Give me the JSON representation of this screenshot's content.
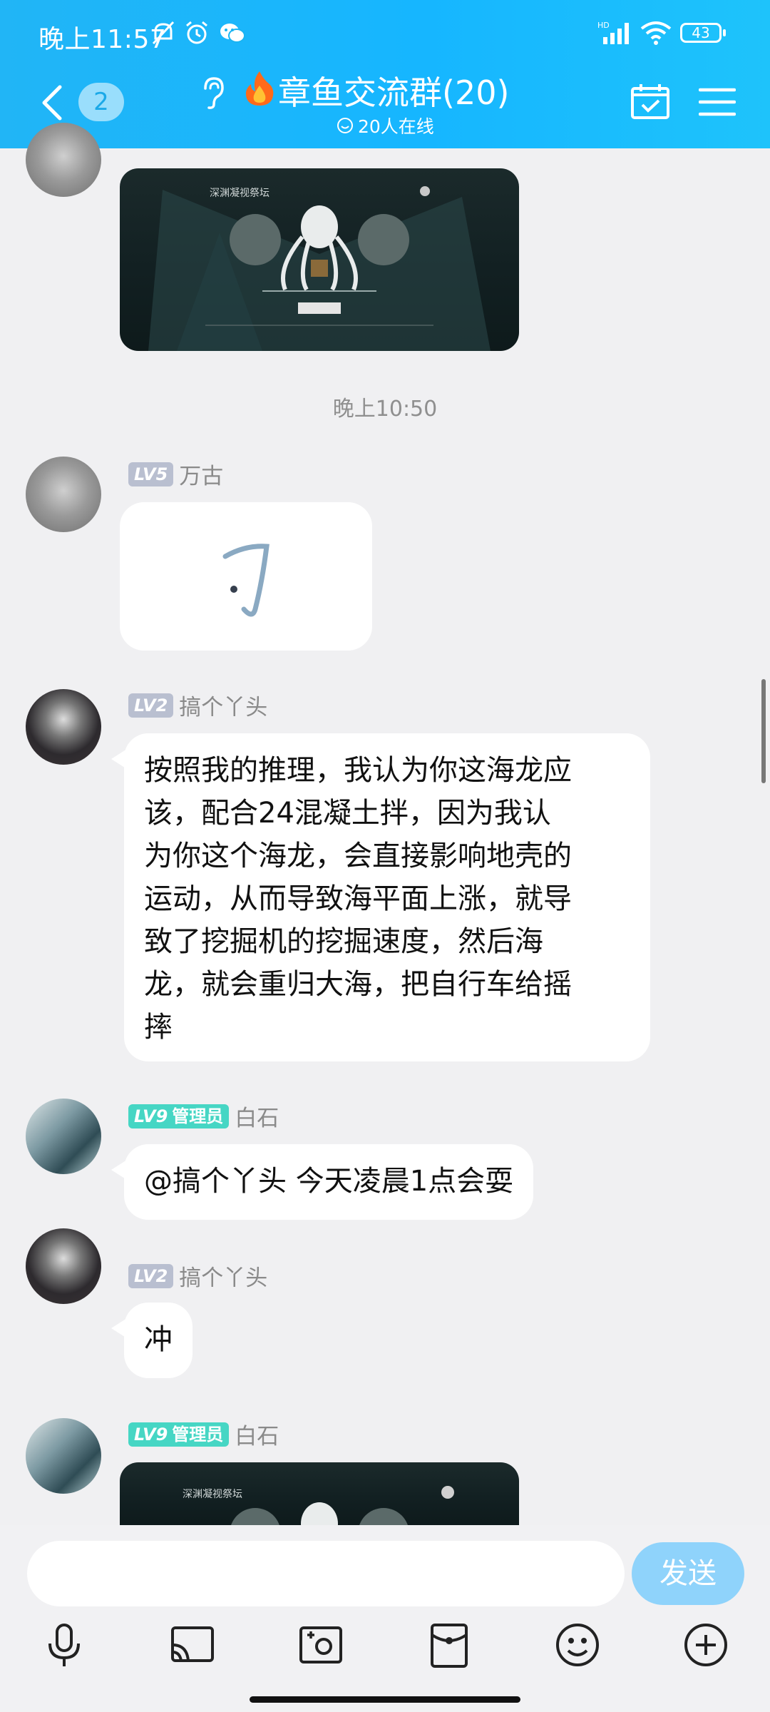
{
  "status_bar": {
    "time": "晚上11:57",
    "battery": "43",
    "hd_label": "HD"
  },
  "header": {
    "unread_count": "2",
    "title": "章鱼交流群(20)",
    "online": "20人在线"
  },
  "messages": [
    {
      "type": "image",
      "image_title": "深渊凝视祭坛"
    },
    {
      "type": "timestamp",
      "text": "晚上10:50"
    },
    {
      "type": "sticker",
      "level": "LV5",
      "sender": "万古",
      "sticker_text": "刁"
    },
    {
      "type": "text",
      "level": "LV2",
      "sender": "搞个丫头",
      "lines": [
        "按照我的推理，我认为你这海龙应",
        "该，配合24混凝土拌，因为我认",
        "为你这个海龙，会直接影响地壳的",
        "运动，从而导致海平面上涨，就导",
        "致了挖掘机的挖掘速度，然后海",
        "龙，就会重归大海，把自行车给摇",
        "摔"
      ]
    },
    {
      "type": "text",
      "level": "LV9",
      "role": "管理员",
      "sender": "白石",
      "text": "@搞个丫头 今天凌晨1点会耍"
    },
    {
      "type": "text",
      "level": "LV2",
      "sender": "搞个丫头",
      "text": "冲"
    },
    {
      "type": "image",
      "level": "LV9",
      "role": "管理员",
      "sender": "白石",
      "image_title": "深渊凝视祭坛"
    }
  ],
  "input": {
    "placeholder": "",
    "send_label": "发送"
  },
  "toolbar": [
    "microphone-icon",
    "cast-screen-icon",
    "camera-icon",
    "red-packet-icon",
    "emoji-icon",
    "plus-icon"
  ],
  "colors": {
    "header": "#16b6ff",
    "send_button": "#8fd3fb",
    "level_badge": "#b9bfd0",
    "admin_badge": "#46d6c4"
  }
}
